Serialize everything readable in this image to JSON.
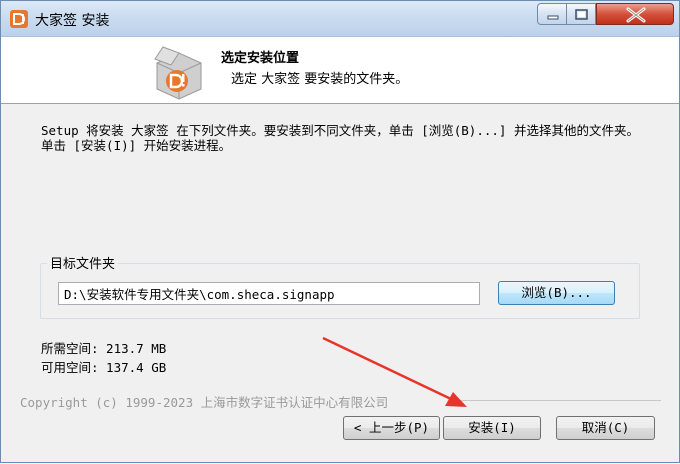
{
  "window": {
    "title": "大家签 安装",
    "colors": {
      "accent_orange": "#e8762c",
      "close_red": "#c0311c",
      "arrow_red": "#e8352b"
    }
  },
  "header": {
    "title": "选定安装位置",
    "subtitle": "选定 大家签 要安装的文件夹。"
  },
  "main": {
    "description": "Setup 将安装 大家签 在下列文件夹。要安装到不同文件夹，单击 [浏览(B)...] 并选择其他的文件夹。 单击 [安装(I)] 开始安装进程。",
    "target_group_label": "目标文件夹",
    "target_path": "D:\\安装软件专用文件夹\\com.sheca.signapp",
    "browse_label": "浏览(B)...",
    "space_required": "所需空间: 213.7 MB",
    "space_available": "可用空间: 137.4 GB"
  },
  "footer": {
    "copyright": "Copyright (c) 1999-2023  上海市数字证书认证中心有限公司",
    "back_label": "< 上一步(P)",
    "install_label": "安装(I)",
    "cancel_label": "取消(C)"
  }
}
